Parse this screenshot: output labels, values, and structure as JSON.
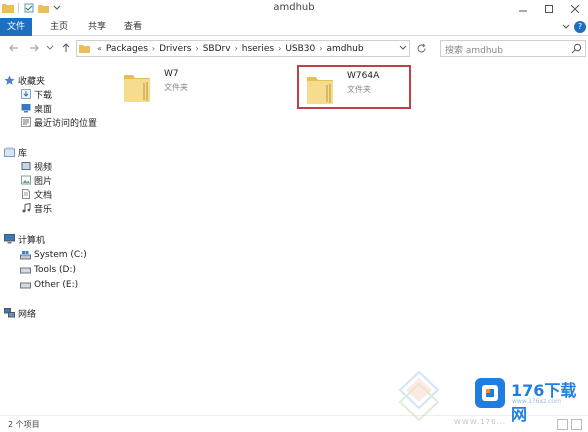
{
  "window": {
    "title": "amdhub"
  },
  "ribbon": {
    "tabs": [
      "文件",
      "主页",
      "共享",
      "查看"
    ]
  },
  "address": {
    "breadcrumbs": [
      "Packages",
      "Drivers",
      "SBDrv",
      "hseries",
      "USB30",
      "amdhub"
    ]
  },
  "search": {
    "placeholder": "搜索 amdhub"
  },
  "nav": {
    "favorites": {
      "label": "收藏夹",
      "items": [
        "下载",
        "桌面",
        "最近访问的位置"
      ]
    },
    "libraries": {
      "label": "库",
      "items": [
        "视频",
        "图片",
        "文档",
        "音乐"
      ]
    },
    "computer": {
      "label": "计算机",
      "items": [
        "System (C:)",
        "Tools (D:)",
        "Other (E:)"
      ]
    },
    "network": {
      "label": "网络"
    }
  },
  "files": [
    {
      "name": "W7",
      "type": "文件夹",
      "highlighted": false
    },
    {
      "name": "W764A",
      "type": "文件夹",
      "highlighted": true
    }
  ],
  "status": {
    "text": "2 个项目"
  },
  "watermark": {
    "title": "176下载网",
    "url": "www.176xz.com",
    "under": "WWW.176..."
  },
  "colors": {
    "accent": "#1e6fc0",
    "highlight_border": "#c0404a",
    "folder": "#f3d27a"
  }
}
